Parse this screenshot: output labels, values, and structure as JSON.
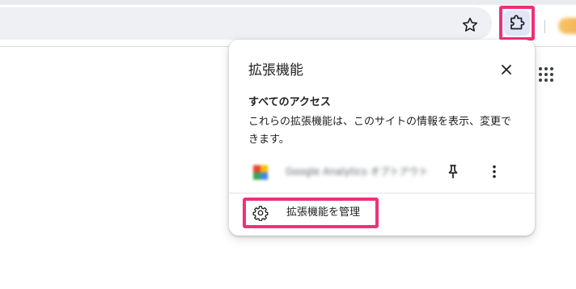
{
  "toolbar": {
    "star_icon": "star-outline-icon",
    "extensions_icon": "puzzle-piece-icon",
    "highlight_color": "#f0307a"
  },
  "popup": {
    "title": "拡張機能",
    "close_icon": "close-icon",
    "section_heading": "すべてのアクセス",
    "section_description": "これらの拡張機能は、このサイトの情報を表示、変更できます。",
    "extensions": [
      {
        "name": "Google Analytics オプトアウト",
        "icon": "google-analytics-favicon",
        "pin_icon": "pin-icon",
        "more_icon": "more-vert-icon"
      }
    ],
    "manage_label": "拡張機能を管理",
    "manage_icon": "gear-icon"
  }
}
